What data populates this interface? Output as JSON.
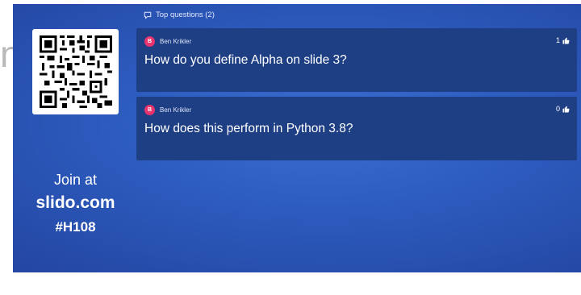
{
  "slide_peek_char": "n",
  "join": {
    "label": "Join at",
    "domain": "slido.com",
    "code": "#H108"
  },
  "top_questions": {
    "header": "Top questions (2)",
    "icon": "chat-bubble-icon",
    "questions": [
      {
        "avatar_letter": "B",
        "author": "Ben Krikler",
        "text": "How do you define Alpha on slide 3?",
        "likes": "1"
      },
      {
        "avatar_letter": "B",
        "author": "Ben Krikler",
        "text": "How does this perform in Python 3.8?",
        "likes": "0"
      }
    ]
  },
  "colors": {
    "panel": "#2d5cbf",
    "card": "#1f3f85",
    "avatar": "#e8336f"
  }
}
